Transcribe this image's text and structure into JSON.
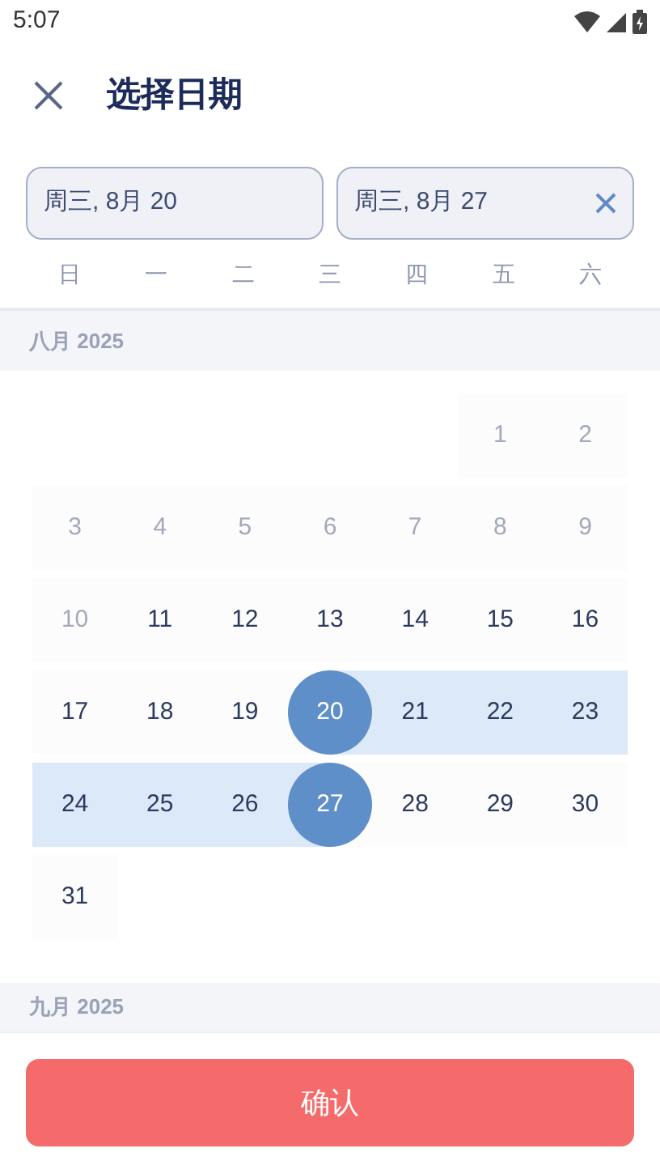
{
  "status_bar": {
    "time": "5:07"
  },
  "header": {
    "title": "选择日期"
  },
  "date_fields": [
    {
      "value": "周三, 8月 20",
      "clearable": false
    },
    {
      "value": "周三, 8月 27",
      "clearable": true
    }
  ],
  "weekdays": [
    "日",
    "一",
    "二",
    "三",
    "四",
    "五",
    "六"
  ],
  "months": [
    {
      "title": "八月 2025",
      "weeks": [
        [
          {
            "kind": "blank"
          },
          {
            "kind": "blank"
          },
          {
            "kind": "blank"
          },
          {
            "kind": "blank"
          },
          {
            "kind": "blank"
          },
          {
            "kind": "day",
            "label": "1",
            "disabled": true,
            "selected": false,
            "in_range": false
          },
          {
            "kind": "day",
            "label": "2",
            "disabled": true,
            "selected": false,
            "in_range": false
          }
        ],
        [
          {
            "kind": "day",
            "label": "3",
            "disabled": true,
            "selected": false,
            "in_range": false
          },
          {
            "kind": "day",
            "label": "4",
            "disabled": true,
            "selected": false,
            "in_range": false
          },
          {
            "kind": "day",
            "label": "5",
            "disabled": true,
            "selected": false,
            "in_range": false
          },
          {
            "kind": "day",
            "label": "6",
            "disabled": true,
            "selected": false,
            "in_range": false
          },
          {
            "kind": "day",
            "label": "7",
            "disabled": true,
            "selected": false,
            "in_range": false
          },
          {
            "kind": "day",
            "label": "8",
            "disabled": true,
            "selected": false,
            "in_range": false
          },
          {
            "kind": "day",
            "label": "9",
            "disabled": true,
            "selected": false,
            "in_range": false
          }
        ],
        [
          {
            "kind": "day",
            "label": "10",
            "disabled": true,
            "selected": false,
            "in_range": false
          },
          {
            "kind": "day",
            "label": "11",
            "disabled": false,
            "selected": false,
            "in_range": false
          },
          {
            "kind": "day",
            "label": "12",
            "disabled": false,
            "selected": false,
            "in_range": false
          },
          {
            "kind": "day",
            "label": "13",
            "disabled": false,
            "selected": false,
            "in_range": false
          },
          {
            "kind": "day",
            "label": "14",
            "disabled": false,
            "selected": false,
            "in_range": false
          },
          {
            "kind": "day",
            "label": "15",
            "disabled": false,
            "selected": false,
            "in_range": false
          },
          {
            "kind": "day",
            "label": "16",
            "disabled": false,
            "selected": false,
            "in_range": false
          }
        ],
        [
          {
            "kind": "day",
            "label": "17",
            "disabled": false,
            "selected": false,
            "in_range": false
          },
          {
            "kind": "day",
            "label": "18",
            "disabled": false,
            "selected": false,
            "in_range": false
          },
          {
            "kind": "day",
            "label": "19",
            "disabled": false,
            "selected": false,
            "in_range": false
          },
          {
            "kind": "day",
            "label": "20",
            "disabled": false,
            "selected": true,
            "in_range": true
          },
          {
            "kind": "day",
            "label": "21",
            "disabled": false,
            "selected": false,
            "in_range": true
          },
          {
            "kind": "day",
            "label": "22",
            "disabled": false,
            "selected": false,
            "in_range": true
          },
          {
            "kind": "day",
            "label": "23",
            "disabled": false,
            "selected": false,
            "in_range": true
          }
        ],
        [
          {
            "kind": "day",
            "label": "24",
            "disabled": false,
            "selected": false,
            "in_range": true
          },
          {
            "kind": "day",
            "label": "25",
            "disabled": false,
            "selected": false,
            "in_range": true
          },
          {
            "kind": "day",
            "label": "26",
            "disabled": false,
            "selected": false,
            "in_range": true
          },
          {
            "kind": "day",
            "label": "27",
            "disabled": false,
            "selected": true,
            "in_range": true
          },
          {
            "kind": "day",
            "label": "28",
            "disabled": false,
            "selected": false,
            "in_range": false
          },
          {
            "kind": "day",
            "label": "29",
            "disabled": false,
            "selected": false,
            "in_range": false
          },
          {
            "kind": "day",
            "label": "30",
            "disabled": false,
            "selected": false,
            "in_range": false
          }
        ],
        [
          {
            "kind": "day",
            "label": "31",
            "disabled": false,
            "selected": false,
            "in_range": false
          }
        ]
      ]
    },
    {
      "title": "九月 2025"
    }
  ],
  "confirm_button": {
    "label": "确认"
  }
}
